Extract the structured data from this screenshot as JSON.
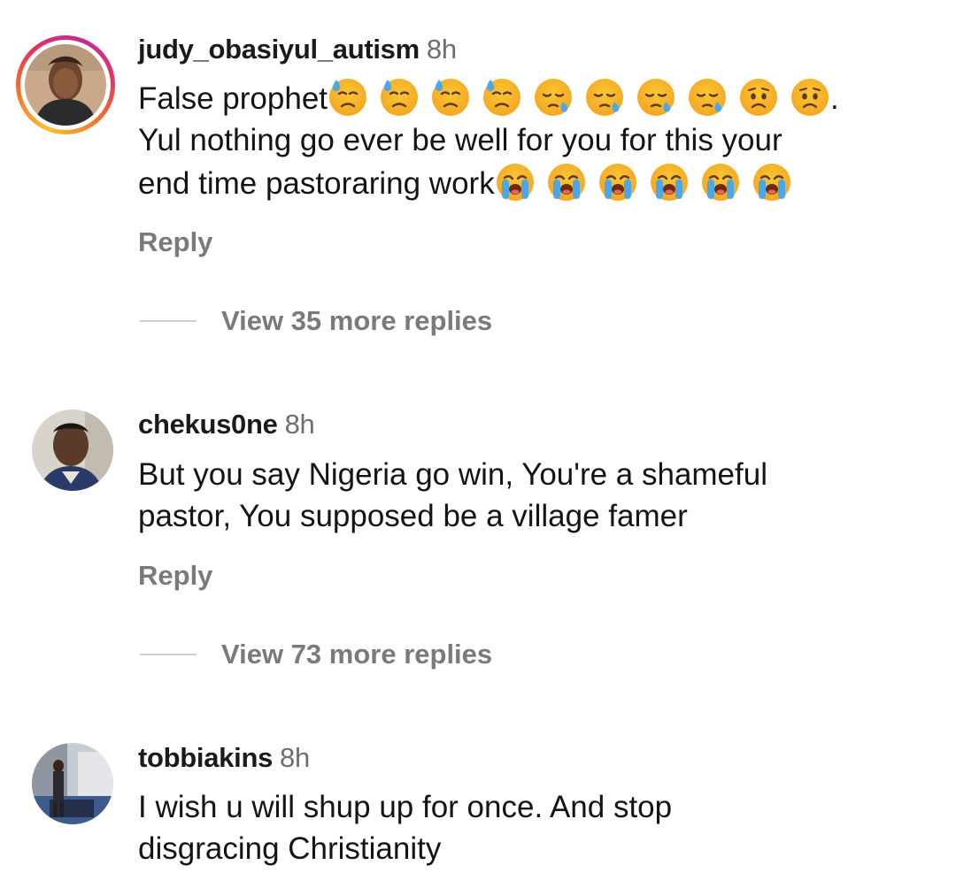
{
  "comments": [
    {
      "username": "judy_obasiyul_autism",
      "time": "8h",
      "line1_text": "False prophet",
      "line1_emojis": [
        "downcast-sweat-emoji",
        "downcast-sweat-emoji",
        "downcast-sweat-emoji",
        "downcast-sweat-emoji",
        "sleepy-face-emoji",
        "sleepy-face-emoji",
        "sleepy-face-emoji",
        "sleepy-face-emoji",
        "worried-face-emoji",
        "worried-face-emoji"
      ],
      "line1_end": ".",
      "line2_text": "Yul nothing go ever be well for you for this your",
      "line3_text": "end time pastoraring work",
      "line3_emojis": [
        "loudly-crying-emoji",
        "loudly-crying-emoji",
        "loudly-crying-emoji",
        "loudly-crying-emoji",
        "loudly-crying-emoji",
        "loudly-crying-emoji"
      ],
      "reply_label": "Reply",
      "view_more_label": "View 35 more replies"
    },
    {
      "username": "chekus0ne",
      "time": "8h",
      "line1_text": "But you say Nigeria go win, You're a shameful",
      "line2_text": "pastor, You supposed be a village famer",
      "reply_label": "Reply",
      "view_more_label": "View 73 more replies"
    },
    {
      "username": "tobbiakins",
      "time": "8h",
      "line1_text": "I wish u will shup up for once. And stop",
      "line2_text": "disgracing Christianity"
    }
  ],
  "colors": {
    "emoji_yellow": "#f9c631",
    "emoji_orange": "#f5a623",
    "tear_blue": "#4aa8e8",
    "meta_gray": "#7a7a7a"
  }
}
